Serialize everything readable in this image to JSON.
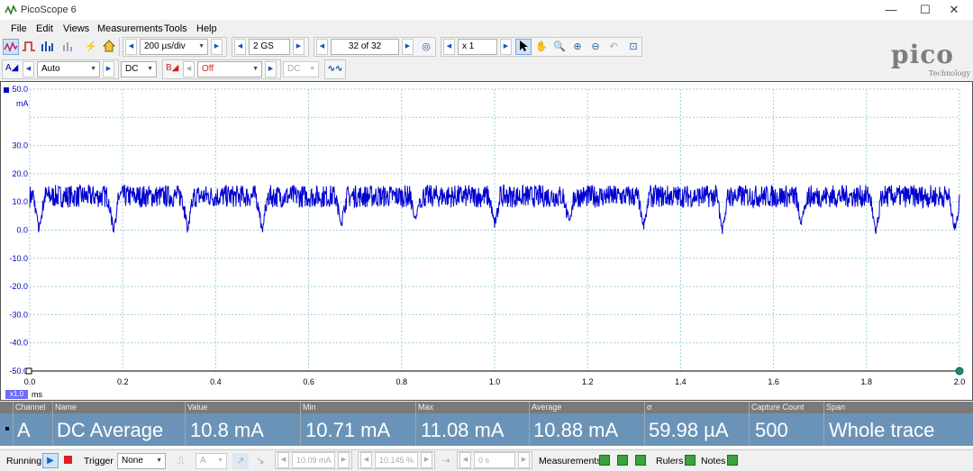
{
  "window": {
    "title": "PicoScope 6",
    "minimize": "—",
    "maximize": "☐",
    "close": "✕"
  },
  "menu": [
    "File",
    "Edit",
    "Views",
    "Measurements",
    "Tools",
    "Help"
  ],
  "toolbar1": {
    "timebase": "200 µs/div",
    "samples": "2 GS",
    "buffer": "32 of 32",
    "zoom": "x 1"
  },
  "toolbar2": {
    "channel_a_label": "A",
    "channel_a_range": "Auto",
    "channel_a_coupling": "DC",
    "channel_b_label": "B",
    "channel_b_range": "Off",
    "channel_b_coupling": "DC"
  },
  "logo": {
    "text": "pico",
    "sub": "Technology"
  },
  "plot": {
    "y_unit": "mA",
    "x_unit": "ms",
    "x_scale_badge": "x1.0",
    "y_ticks": [
      "50.0",
      "30.0",
      "20.0",
      "10.0",
      "0.0",
      "-10.0",
      "-20.0",
      "-30.0",
      "-40.0",
      "-50.0"
    ],
    "x_ticks": [
      "0.0",
      "0.2",
      "0.4",
      "0.6",
      "0.8",
      "1.0",
      "1.2",
      "1.4",
      "1.6",
      "1.8",
      "2.0"
    ],
    "trace_color": "#0000d0",
    "grid_color": "#9ccfd8"
  },
  "chart_data": {
    "type": "line",
    "title": "",
    "xlabel": "ms",
    "ylabel": "mA",
    "xlim": [
      0,
      2.0
    ],
    "ylim": [
      -50,
      50
    ],
    "grid": true,
    "series": [
      {
        "baseline": 12.0,
        "noise_amplitude": 4.0,
        "dips_x": [
          0.02,
          0.18,
          0.34,
          0.5,
          0.67,
          0.83,
          1.0,
          1.16,
          1.32,
          1.49,
          1.66,
          1.82,
          1.99
        ],
        "dips_y": [
          0,
          0,
          0,
          0,
          2,
          3,
          2,
          3,
          1,
          0,
          2,
          -2,
          0
        ]
      }
    ]
  },
  "measurements": {
    "headers": [
      "Channel",
      "Name",
      "Value",
      "Min",
      "Max",
      "Average",
      "σ",
      "Capture Count",
      "Span"
    ],
    "row": [
      "A",
      "DC Average",
      "10.8 mA",
      "10.71 mA",
      "11.08 mA",
      "10.88 mA",
      "59.98 µA",
      "500",
      "Whole trace"
    ]
  },
  "status": {
    "running": "Running",
    "trigger": "Trigger",
    "trigger_mode": "None",
    "trigger_channel": "A",
    "trigger_time": "10.09 mA",
    "pre_trigger": "10.145 %",
    "delay": "0 s",
    "measurements": "Measurements",
    "rulers": "Rulers",
    "notes": "Notes"
  }
}
